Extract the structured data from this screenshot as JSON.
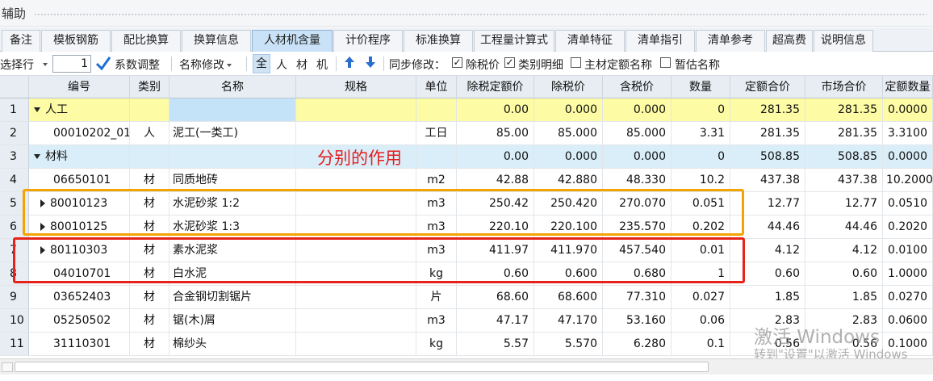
{
  "window": {
    "title": "辅助"
  },
  "tabs": [
    "备注",
    "模板钢筋",
    "配比换算",
    "换算信息",
    "人材机含量",
    "计价程序",
    "标准换算",
    "工程量计算式",
    "清单特征",
    "清单指引",
    "清单参考",
    "超高费",
    "说明信息"
  ],
  "active_tab": "人材机含量",
  "toolbar": {
    "select_row_label": "选择行",
    "row_number": "1",
    "coefficient_adjust": "系数调整",
    "name_modify": "名称修改",
    "filters": [
      "全",
      "人",
      "材",
      "机"
    ],
    "sync_modify_label": "同步修改：",
    "sync_options": [
      {
        "label": "除税价",
        "checked": true
      },
      {
        "label": "类别明细",
        "checked": true
      },
      {
        "label": "主材定额名称",
        "checked": false
      },
      {
        "label": "暂估名称",
        "checked": false
      }
    ]
  },
  "columns": [
    "编号",
    "类别",
    "名称",
    "规格",
    "单位",
    "除税定额价",
    "除税价",
    "含税价",
    "数量",
    "定额合价",
    "市场合价",
    "定额数量"
  ],
  "rows": [
    {
      "n": "1",
      "code": "人工",
      "cat": "",
      "name": "",
      "spec": "",
      "unit": "",
      "p1": "0.00",
      "p2": "0.000",
      "p3": "0.000",
      "qty": "0",
      "t1": "281.35",
      "t2": "281.35",
      "q2": "0.0000",
      "type": "labor",
      "expand": "down"
    },
    {
      "n": "2",
      "code": "00010202_01",
      "cat": "人",
      "name": "泥工(一类工)",
      "spec": "",
      "unit": "工日",
      "p1": "85.00",
      "p2": "85.000",
      "p3": "85.000",
      "qty": "3.31",
      "t1": "281.35",
      "t2": "281.35",
      "q2": "3.3100",
      "type": "item",
      "expand": ""
    },
    {
      "n": "3",
      "code": "材料",
      "cat": "",
      "name": "",
      "spec": "",
      "unit": "",
      "p1": "0.00",
      "p2": "0.000",
      "p3": "0.000",
      "qty": "0",
      "t1": "508.85",
      "t2": "508.85",
      "q2": "0.0000",
      "type": "material",
      "expand": "down"
    },
    {
      "n": "4",
      "code": "06650101",
      "cat": "材",
      "name": "同质地砖",
      "spec": "",
      "unit": "m2",
      "p1": "42.88",
      "p2": "42.880",
      "p3": "48.330",
      "qty": "10.2",
      "t1": "437.38",
      "t2": "437.38",
      "q2": "10.2000",
      "type": "item",
      "expand": ""
    },
    {
      "n": "5",
      "code": "80010123",
      "cat": "材",
      "name": "水泥砂浆 1:2",
      "spec": "",
      "unit": "m3",
      "p1": "250.42",
      "p2": "250.420",
      "p3": "270.070",
      "qty": "0.051",
      "t1": "12.77",
      "t2": "12.77",
      "q2": "0.0510",
      "type": "item",
      "expand": "right"
    },
    {
      "n": "6",
      "code": "80010125",
      "cat": "材",
      "name": "水泥砂浆 1:3",
      "spec": "",
      "unit": "m3",
      "p1": "220.10",
      "p2": "220.100",
      "p3": "235.570",
      "qty": "0.202",
      "t1": "44.46",
      "t2": "44.46",
      "q2": "0.2020",
      "type": "item",
      "expand": "right"
    },
    {
      "n": "7",
      "code": "80110303",
      "cat": "材",
      "name": "素水泥浆",
      "spec": "",
      "unit": "m3",
      "p1": "411.97",
      "p2": "411.970",
      "p3": "457.540",
      "qty": "0.01",
      "t1": "4.12",
      "t2": "4.12",
      "q2": "0.0100",
      "type": "item",
      "expand": "right"
    },
    {
      "n": "8",
      "code": "04010701",
      "cat": "材",
      "name": "白水泥",
      "spec": "",
      "unit": "kg",
      "p1": "0.60",
      "p2": "0.600",
      "p3": "0.680",
      "qty": "1",
      "t1": "0.60",
      "t2": "0.60",
      "q2": "1.0000",
      "type": "item",
      "expand": ""
    },
    {
      "n": "9",
      "code": "03652403",
      "cat": "材",
      "name": "合金钢切割锯片",
      "spec": "",
      "unit": "片",
      "p1": "68.60",
      "p2": "68.600",
      "p3": "77.310",
      "qty": "0.027",
      "t1": "1.85",
      "t2": "1.85",
      "q2": "0.0270",
      "type": "item",
      "expand": ""
    },
    {
      "n": "10",
      "code": "05250502",
      "cat": "材",
      "name": "锯(木)屑",
      "spec": "",
      "unit": "m3",
      "p1": "47.17",
      "p2": "47.170",
      "p3": "53.160",
      "qty": "0.06",
      "t1": "2.83",
      "t2": "2.83",
      "q2": "0.0600",
      "type": "item",
      "expand": ""
    },
    {
      "n": "11",
      "code": "31110301",
      "cat": "材",
      "name": "棉纱头",
      "spec": "",
      "unit": "kg",
      "p1": "5.57",
      "p2": "5.570",
      "p3": "6.280",
      "qty": "0.1",
      "t1": "0.56",
      "t2": "0.56",
      "q2": "0.1000",
      "type": "item",
      "expand": ""
    }
  ],
  "annotation": "分别的作用",
  "watermark": {
    "line1": "激活 Windows",
    "line2": "转到\"设置\"以激活 Windows"
  }
}
